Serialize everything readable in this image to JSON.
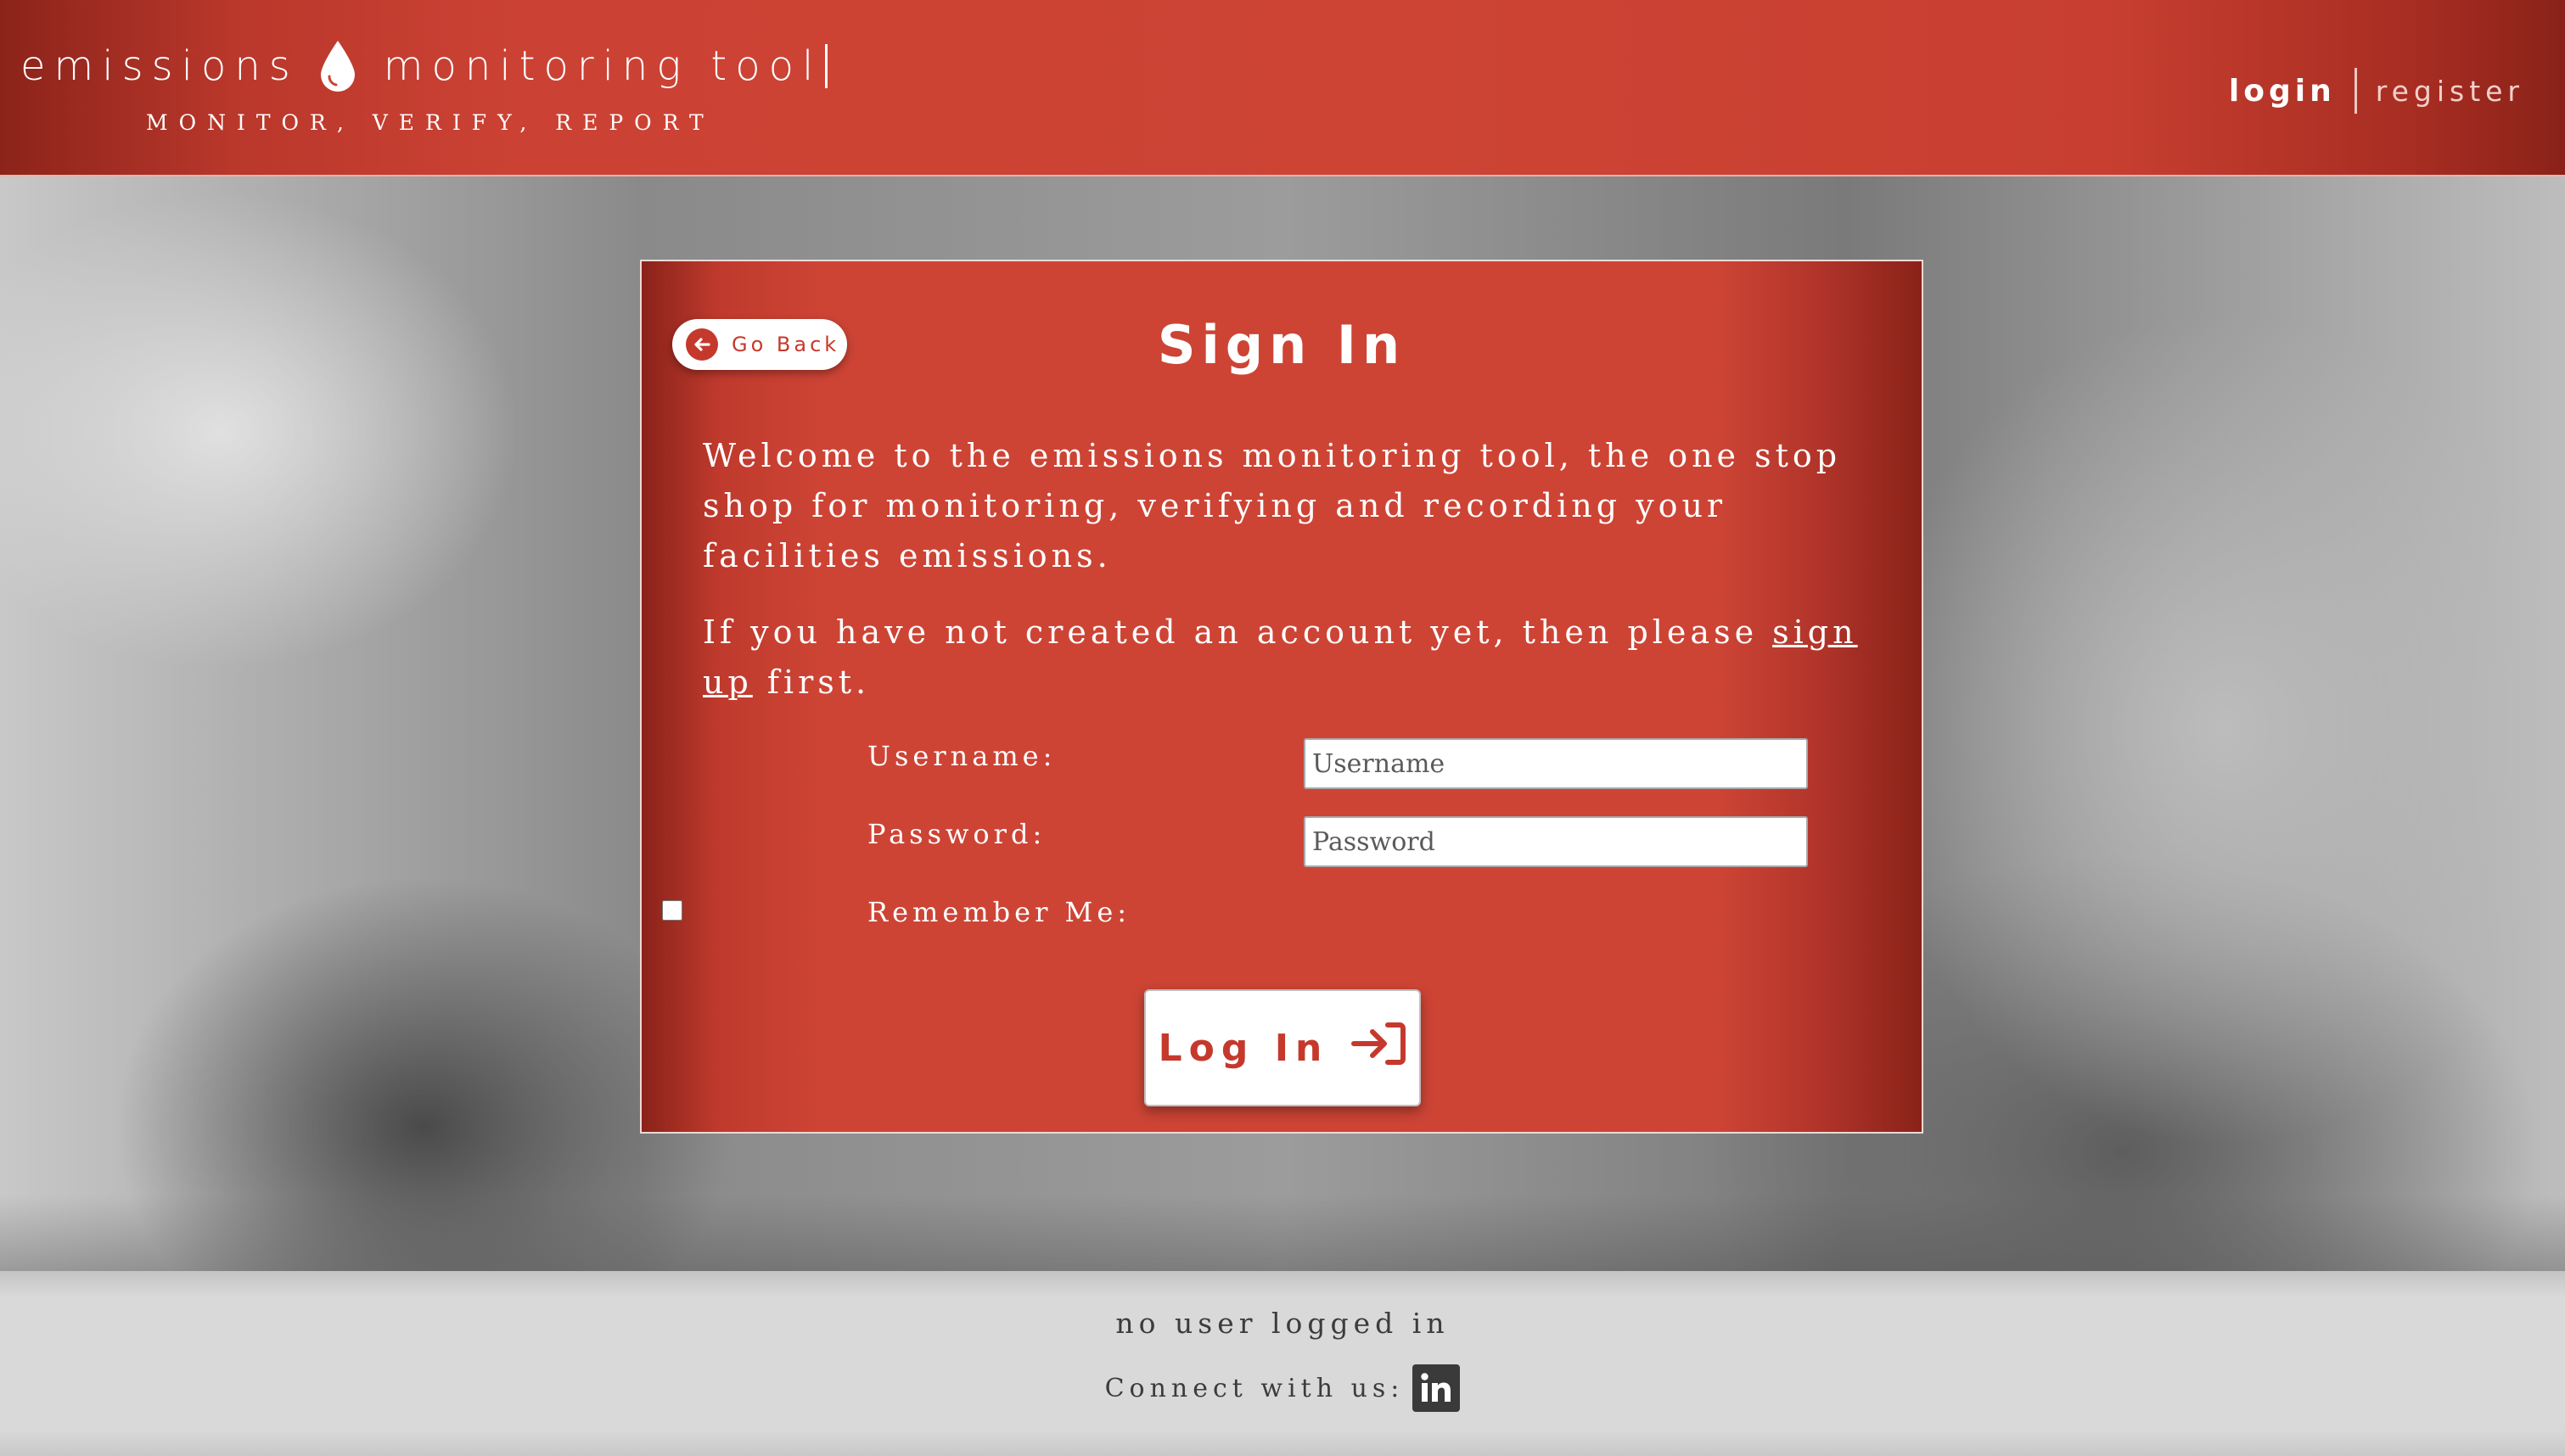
{
  "header": {
    "brand_left": "emissions",
    "brand_right": "monitoring tool",
    "tagline": "MONITOR, VERIFY, REPORT",
    "nav": {
      "login": "login",
      "register": "register"
    }
  },
  "card": {
    "go_back": "Go Back",
    "title": "Sign In",
    "intro": "Welcome to the emissions monitoring tool, the one stop shop for monitoring, verifying and recording your facilities emissions.",
    "signup_prefix": "If you have not created an account yet, then please ",
    "signup_link": "sign up",
    "signup_suffix": " first.",
    "form": {
      "username_label": "Username:",
      "username_placeholder": "Username",
      "password_label": "Password:",
      "password_placeholder": "Password",
      "remember_label": "Remember Me:",
      "remember_checked": false
    },
    "submit": "Log In"
  },
  "footer": {
    "status": "no user logged in",
    "connect": "Connect with us:",
    "social": "linkedin-icon"
  },
  "colors": {
    "brand_red": "#cd4435",
    "brand_dark": "#8a2219",
    "footer_bg": "#d9d9d9"
  }
}
